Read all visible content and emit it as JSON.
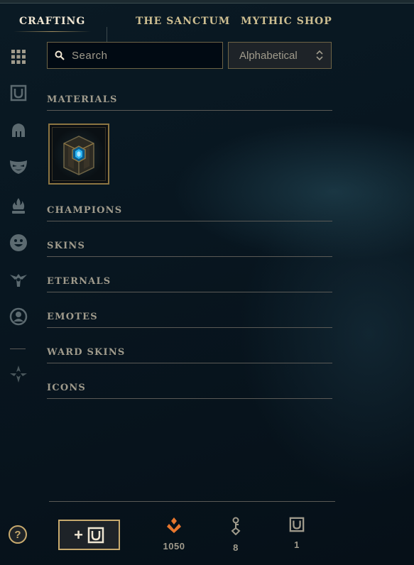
{
  "nav": {
    "tabs": [
      {
        "label": "CRAFTING",
        "active": true
      },
      {
        "label": "THE SANCTUM",
        "active": false
      },
      {
        "label": "MYTHIC SHOP",
        "active": false
      }
    ]
  },
  "sidebar": {
    "icons": [
      "grid-icon",
      "chest-icon",
      "helmet-icon",
      "mask-icon",
      "flame-icon",
      "emote-icon",
      "ward-icon",
      "profile-icon",
      "eternals-icon"
    ]
  },
  "search": {
    "placeholder": "Search",
    "value": ""
  },
  "sort": {
    "selected": "Alphabetical"
  },
  "sections": [
    "MATERIALS",
    "CHAMPIONS",
    "SKINS",
    "ETERNALS",
    "EMOTES",
    "WARD SKINS",
    "ICONS"
  ],
  "materials": [
    {
      "name": "Hextech Chest",
      "icon": "hextech-chest-icon"
    }
  ],
  "footer": {
    "help_label": "?",
    "add_label": "+",
    "currencies": [
      {
        "icon": "orange-essence-icon",
        "value": "1050"
      },
      {
        "icon": "key-icon",
        "value": "8"
      },
      {
        "icon": "chest-icon",
        "value": "1"
      }
    ]
  },
  "colors": {
    "gold": "#c8aa6e",
    "text": "#a09b8c",
    "orange": "#e8772e"
  }
}
